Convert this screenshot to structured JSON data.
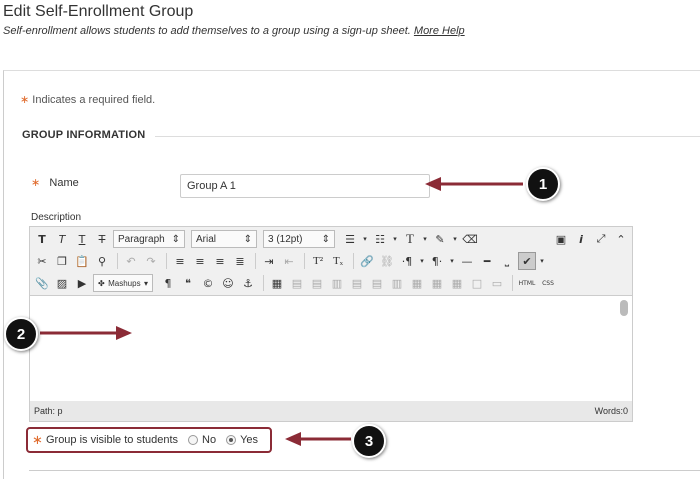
{
  "page": {
    "title": "Edit Self-Enrollment Group",
    "intro": "Self-enrollment allows students to add themselves to a group using a sign-up sheet.",
    "more_help": "More Help"
  },
  "form": {
    "required_note": "Indicates a required field.",
    "section_title": "GROUP INFORMATION",
    "name_label": "Name",
    "name_value": "Group A 1",
    "description_label": "Description",
    "visibility_label": "Group is visible to students",
    "option_no": "No",
    "option_yes": "Yes",
    "selected_option": "Yes"
  },
  "editor": {
    "paragraph_select": "Paragraph",
    "font_select": "Arial",
    "size_select": "3 (12pt)",
    "mashups": "Mashups",
    "path": "Path: p",
    "words": "Words:0",
    "html_label": "HTML",
    "css_label": "CSS"
  },
  "callouts": {
    "one": "1",
    "two": "2",
    "three": "3"
  },
  "colors": {
    "required_star": "#e06b2d",
    "callout_arrow": "#8b2b36",
    "badge": "#111111"
  }
}
